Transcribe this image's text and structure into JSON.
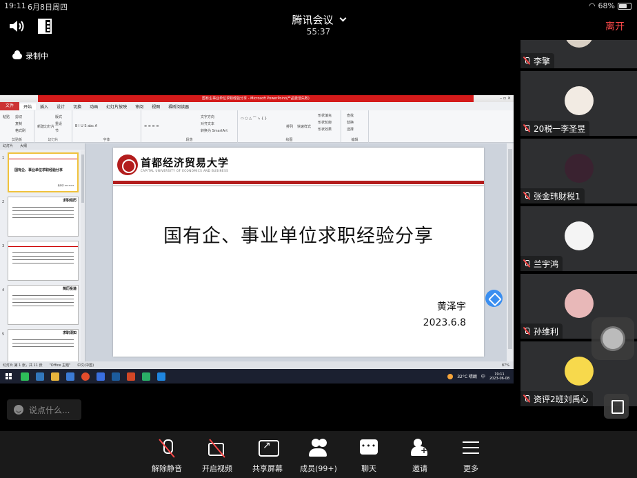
{
  "status_bar": {
    "time": "19:11",
    "date": "6月8日周四",
    "battery": "68%"
  },
  "meeting": {
    "title": "腾讯会议",
    "timer": "55:37",
    "leave_label": "离开",
    "recording_label": "录制中"
  },
  "ppt": {
    "window_title": "国有企事业单位求职经验分享 - Microsoft PowerPoint(产品激活失败)",
    "menu": [
      "文件",
      "开始",
      "插入",
      "设计",
      "切换",
      "动画",
      "幻灯片放映",
      "审阅",
      "视图",
      "福昕阅读器"
    ],
    "ribbon_groups": [
      "剪贴板",
      "幻灯片",
      "字体",
      "段落",
      "绘图",
      "编辑"
    ],
    "ribbon_items": {
      "paste": "粘贴",
      "cut": "剪切",
      "copy": "复制",
      "format_painter": "格式刷",
      "new_slide": "新建幻灯片",
      "layout": "版式",
      "reset": "重设",
      "section": "节",
      "text_direction": "文字方向",
      "align_text": "对齐文本",
      "smartart": "转换为 SmartArt",
      "arrange": "排列",
      "quick_styles": "快速样式",
      "shape_fill": "形状填充",
      "shape_outline": "形状轮廓",
      "shape_effects": "形状效果",
      "find": "查找",
      "replace": "替换",
      "select": "选择"
    },
    "thumb_tabs": [
      "幻灯片",
      "大纲"
    ],
    "thumbnails": [
      {
        "num": "1",
        "title": "国有企、事业单位求职经验分享",
        "small": "黄泽宇 2023.6.8"
      },
      {
        "num": "2",
        "title": "求职经历",
        "small": ""
      },
      {
        "num": "3",
        "title": "",
        "small": ""
      },
      {
        "num": "4",
        "title": "简历投递",
        "small": ""
      },
      {
        "num": "5",
        "title": "求职须知",
        "small": ""
      }
    ],
    "slide": {
      "school_cn": "首都经济贸易大学",
      "school_en": "CAPITAL UNIVERSITY OF ECONOMICS AND BUSINESS",
      "title": "国有企、事业单位求职经验分享",
      "presenter": "黄泽宇",
      "date": "2023.6.8"
    },
    "statusbar": {
      "slide_info": "幻灯片 第 1 张，共 11 张",
      "theme": "\"Office 主题\"",
      "language": "中文(中国)",
      "zoom": "87%"
    },
    "taskbar": {
      "weather": "32°C 晴朗",
      "ime": "中",
      "clock_time": "19:11",
      "clock_date": "2023-06-08"
    }
  },
  "chat": {
    "placeholder": "说点什么..."
  },
  "participants": [
    {
      "name": "李擎",
      "avatar_color": "#d9d0c4"
    },
    {
      "name": "20税一李圣昱",
      "avatar_color": "#f2ebe3"
    },
    {
      "name": "张金玮财税1",
      "avatar_color": "#3a2230"
    },
    {
      "name": "兰宇鸿",
      "avatar_color": "#f4f4f4"
    },
    {
      "name": "孙维利",
      "avatar_color": "#e8b8b8"
    },
    {
      "name": "资评2班刘禹心",
      "avatar_color": "#f7d94c"
    }
  ],
  "toolbar": {
    "unmute": "解除静音",
    "start_video": "开启视频",
    "share_screen": "共享屏幕",
    "members": "成员(99+)",
    "chat": "聊天",
    "invite": "邀请",
    "more": "更多"
  }
}
